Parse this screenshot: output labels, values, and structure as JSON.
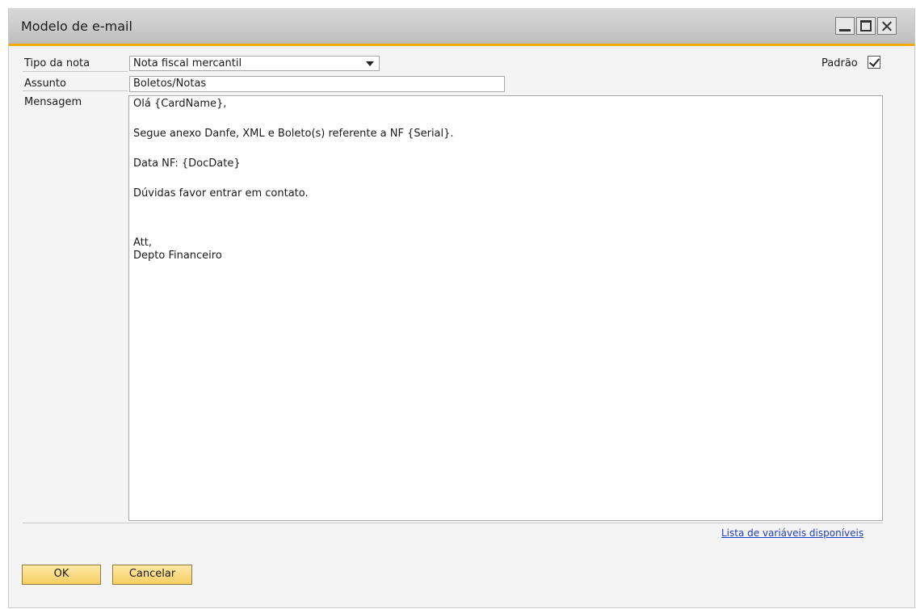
{
  "window": {
    "title": "Modelo de e-mail"
  },
  "form": {
    "tipo_label": "Tipo da nota",
    "tipo_value": "Nota fiscal mercantil",
    "assunto_label": "Assunto",
    "assunto_value": "Boletos/Notas",
    "mensagem_label": "Mensagem",
    "padrao_label": "Padrão",
    "padrao_checked": true
  },
  "message": {
    "line1": "Olá {CardName},",
    "line2": "Segue anexo Danfe, XML e Boleto(s) referente a NF {Serial}.",
    "line3": "Data NF: {DocDate}",
    "line4": "Dúvidas favor entrar em contato.",
    "line5": "Att,",
    "line6": "Depto Financeiro"
  },
  "links": {
    "variables": "Lista de variáveis disponíveis"
  },
  "buttons": {
    "ok": "OK",
    "cancel": "Cancelar"
  },
  "colors": {
    "accent": "#f0ab00",
    "button": "#f6cf62",
    "link": "#1f3fbf"
  }
}
